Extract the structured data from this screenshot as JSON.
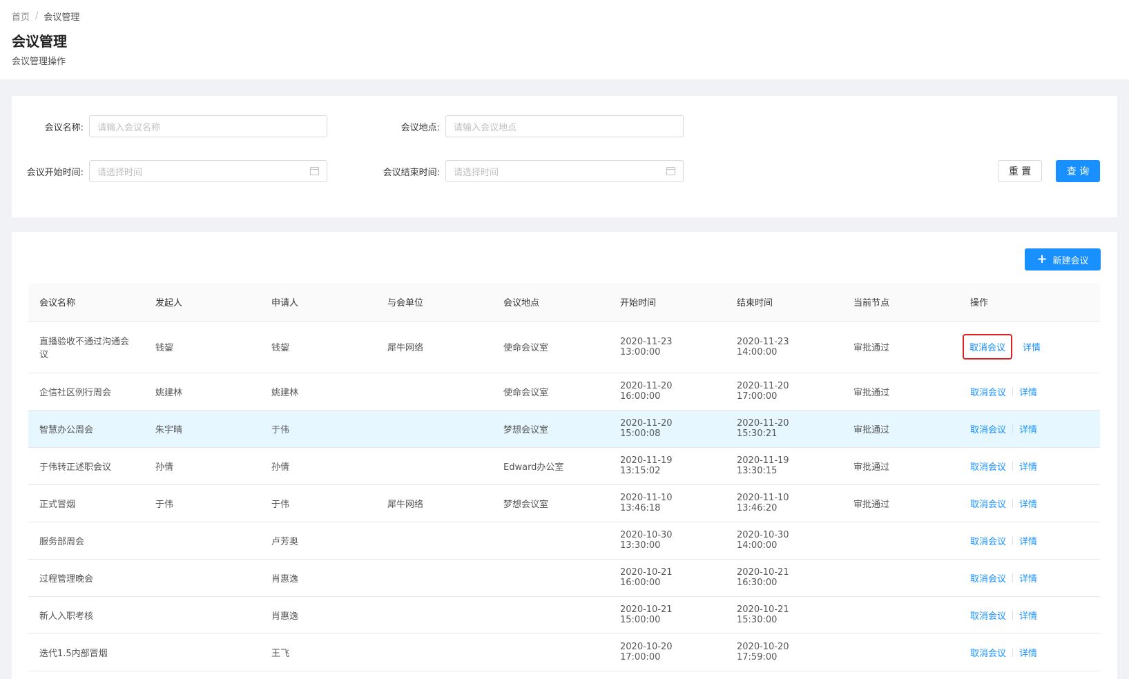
{
  "breadcrumb": {
    "home": "首页",
    "separator": "/",
    "current": "会议管理"
  },
  "page": {
    "title": "会议管理",
    "description": "会议管理操作"
  },
  "filters": {
    "name_label": "会议名称:",
    "name_placeholder": "请输入会议名称",
    "location_label": "会议地点:",
    "location_placeholder": "请输入会议地点",
    "start_label": "会议开始时间:",
    "start_placeholder": "请选择时间",
    "end_label": "会议结束时间:",
    "end_placeholder": "请选择时间",
    "reset_label": "重 置",
    "query_label": "查 询"
  },
  "toolbar": {
    "new_label": "新建会议",
    "new_icon": "plus-icon"
  },
  "table": {
    "columns": [
      "会议名称",
      "发起人",
      "申请人",
      "与会单位",
      "会议地点",
      "开始时间",
      "结束时间",
      "当前节点",
      "操作"
    ],
    "rows": [
      [
        "直播验收不通过沟通会议",
        "钱鋆",
        "钱鋆",
        "犀牛网络",
        "使命会议室",
        "2020-11-23 13:00:00",
        "2020-11-23 14:00:00",
        "审批通过"
      ],
      [
        "企信社区例行周会",
        "姚建林",
        "姚建林",
        "",
        "使命会议室",
        "2020-11-20 16:00:00",
        "2020-11-20 17:00:00",
        "审批通过"
      ],
      [
        "智慧办公周会",
        "朱宇晴",
        "于伟",
        "",
        "梦想会议室",
        "2020-11-20 15:00:08",
        "2020-11-20 15:30:21",
        "审批通过"
      ],
      [
        "于伟转正述职会议",
        "孙倩",
        "孙倩",
        "",
        "Edward办公室",
        "2020-11-19 13:15:02",
        "2020-11-19 13:30:15",
        "审批通过"
      ],
      [
        "正式冒烟",
        "于伟",
        "于伟",
        "犀牛网络",
        "梦想会议室",
        "2020-11-10 13:46:18",
        "2020-11-10 13:46:20",
        "审批通过"
      ],
      [
        "服务部周会",
        "",
        "卢芳奥",
        "",
        "",
        "2020-10-30 13:30:00",
        "2020-10-30 14:00:00",
        ""
      ],
      [
        "过程管理晚会",
        "",
        "肖惠逸",
        "",
        "",
        "2020-10-21 16:00:00",
        "2020-10-21 16:30:00",
        ""
      ],
      [
        "新人入职考核",
        "",
        "肖惠逸",
        "",
        "",
        "2020-10-21 15:00:00",
        "2020-10-21 15:30:00",
        ""
      ],
      [
        "迭代1.5内部冒烟",
        "",
        "王飞",
        "",
        "",
        "2020-10-20 17:00:00",
        "2020-10-20 17:59:00",
        ""
      ]
    ],
    "actions": {
      "cancel": "取消会议",
      "detail": "详情"
    }
  },
  "colors": {
    "accent": "#1890ff",
    "highlight_row": "#e6f7ff",
    "annotation_box": "#e02020"
  }
}
